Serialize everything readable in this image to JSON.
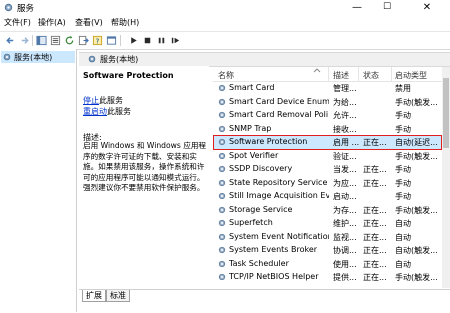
{
  "window": {
    "title": "服务",
    "min_glyph": "—",
    "max_glyph": "☐",
    "close_glyph": "✕"
  },
  "menu": [
    "文件(F)",
    "操作(A)",
    "查看(V)",
    "帮助(H)"
  ],
  "tree": {
    "item": "服务(本地)"
  },
  "pane_header": "服务(本地)",
  "detail": {
    "service_name": "Software Protection",
    "stop_prefix": "停止",
    "stop_suffix": "此服务",
    "restart_prefix": "重启动",
    "restart_suffix": "此服务",
    "desc_label": "描述:",
    "desc_text": "启用 Windows 和 Windows 应用程序的数字许可证的下载、安装和实施。如果禁用该服务，操作系统和许可的应用程序可能以通知模式运行。强烈建议你不要禁用软件保护服务。"
  },
  "list": {
    "columns": [
      "名称",
      "描述",
      "状态",
      "启动类型"
    ],
    "rows": [
      {
        "name": "Smart Card",
        "desc": "管理...",
        "status": "",
        "startup": "禁用",
        "selected": false
      },
      {
        "name": "Smart Card Device Enum...",
        "desc": "为给...",
        "status": "",
        "startup": "手动(触发...",
        "selected": false
      },
      {
        "name": "Smart Card Removal Poli...",
        "desc": "允许...",
        "status": "",
        "startup": "手动",
        "selected": false
      },
      {
        "name": "SNMP Trap",
        "desc": "接收...",
        "status": "",
        "startup": "手动",
        "selected": false
      },
      {
        "name": "Software Protection",
        "desc": "启用 ...",
        "status": "正在...",
        "startup": "自动(延迟...",
        "selected": true
      },
      {
        "name": "Spot Verifier",
        "desc": "验证...",
        "status": "",
        "startup": "手动(触发...",
        "selected": false
      },
      {
        "name": "SSDP Discovery",
        "desc": "当发...",
        "status": "正在...",
        "startup": "手动",
        "selected": false
      },
      {
        "name": "State Repository Service",
        "desc": "为应...",
        "status": "正在...",
        "startup": "手动",
        "selected": false
      },
      {
        "name": "Still Image Acquisition Ev...",
        "desc": "启动...",
        "status": "",
        "startup": "手动",
        "selected": false
      },
      {
        "name": "Storage Service",
        "desc": "为存...",
        "status": "正在...",
        "startup": "手动(触发...",
        "selected": false
      },
      {
        "name": "Superfetch",
        "desc": "维护...",
        "status": "正在...",
        "startup": "自动",
        "selected": false
      },
      {
        "name": "System Event Notification...",
        "desc": "监视...",
        "status": "正在...",
        "startup": "自动",
        "selected": false
      },
      {
        "name": "System Events Broker",
        "desc": "协调...",
        "status": "正在...",
        "startup": "自动(触发...",
        "selected": false
      },
      {
        "name": "Task Scheduler",
        "desc": "使用...",
        "status": "正在...",
        "startup": "自动",
        "selected": false
      },
      {
        "name": "TCP/IP NetBIOS Helper",
        "desc": "提供...",
        "status": "正在...",
        "startup": "手动(触发...",
        "selected": false
      }
    ]
  },
  "tabs": [
    "扩展",
    "标准"
  ],
  "colors": {
    "highlight_border": "#e02020",
    "selection": "#cce8ff",
    "link": "#0033cc"
  }
}
